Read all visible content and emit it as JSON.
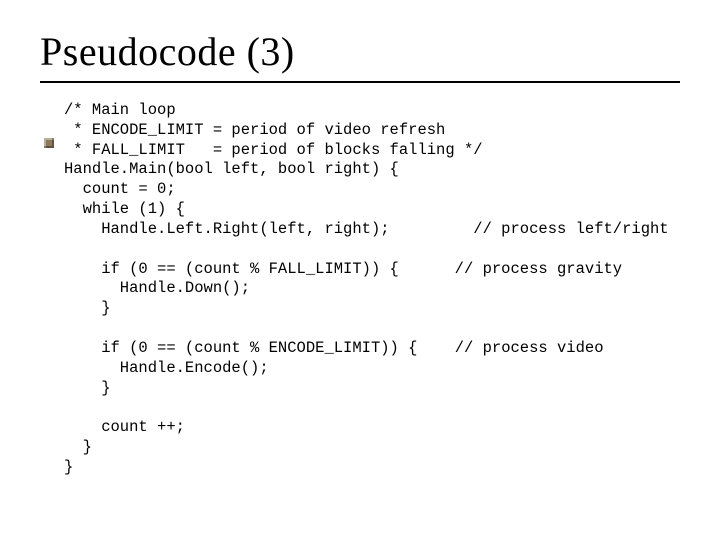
{
  "title": "Pseudocode (3)",
  "code": {
    "l01": "/* Main loop",
    "l02": " * ENCODE_LIMIT = period of video refresh",
    "l03": " * FALL_LIMIT   = period of blocks falling */",
    "l04": "Handle.Main(bool left, bool right) {",
    "l05": "  count = 0;",
    "l06": "  while (1) {",
    "l07a": "    Handle.Left.Right(left, right);",
    "l07pad": "         ",
    "l07b": "// process left/right",
    "l08": "",
    "l09a": "    if (0 == (count % FALL_LIMIT)) {",
    "l09pad": "      ",
    "l09b": "// process gravity",
    "l10": "      Handle.Down();",
    "l11": "    }",
    "l12": "",
    "l13a": "    if (0 == (count % ENCODE_LIMIT)) {",
    "l13pad": "    ",
    "l13b": "// process video",
    "l14": "      Handle.Encode();",
    "l15": "    }",
    "l16": "",
    "l17": "    count ++;",
    "l18": "  }",
    "l19": "}"
  }
}
